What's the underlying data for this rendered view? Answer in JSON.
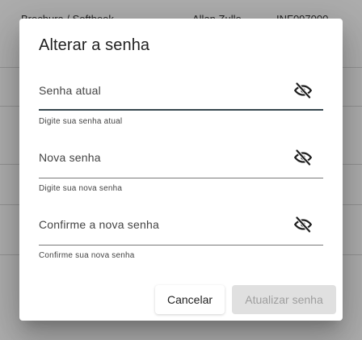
{
  "background": {
    "header_items": [
      "Brochura / Softbook",
      "Allan Zullo",
      "INF097000"
    ]
  },
  "dialog": {
    "title": "Alterar a senha",
    "fields": [
      {
        "label": "Senha atual",
        "hint": "Digite sua senha atual",
        "icon": "eye-off-icon"
      },
      {
        "label": "Nova senha",
        "hint": "Digite sua nova senha",
        "icon": "eye-off-icon"
      },
      {
        "label": "Confirme a nova senha",
        "hint": "Confirme sua nova senha",
        "icon": "eye-off-icon"
      }
    ],
    "buttons": {
      "cancel_label": "Cancelar",
      "update_label": "Atualizar senha"
    }
  },
  "colors": {
    "overlay": "#000000",
    "disabled_button_bg": "#e0e0e0",
    "disabled_button_text": "#9e9e9e",
    "focused_underline": "#37474f"
  }
}
